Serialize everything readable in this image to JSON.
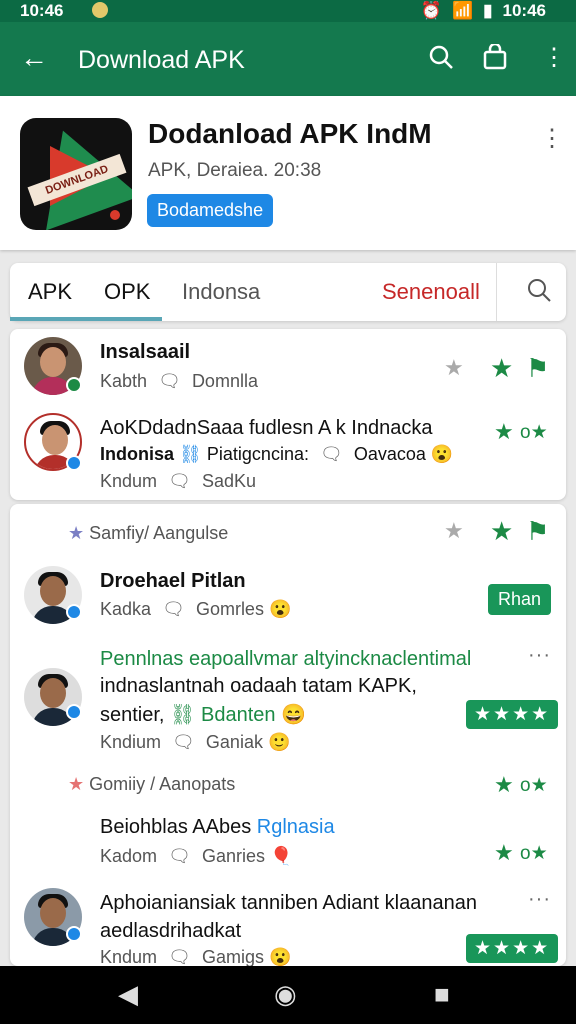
{
  "status_bar": {
    "time": "10:46",
    "right_time": "10:46"
  },
  "app_bar": {
    "title": "Download APK",
    "icons": [
      "back-arrow-icon",
      "search-icon",
      "bag-icon",
      "more-vert-icon"
    ]
  },
  "app": {
    "name": "Dodanload APK IndM",
    "subtitle": "APK, Deraiea. 20:38",
    "badge": "Bodamedshe",
    "icon_text": "DOWNLOAD"
  },
  "tabs": [
    {
      "label": "APK"
    },
    {
      "label": "OPK"
    },
    {
      "label": "Indonsa"
    },
    {
      "label": "Senenoall"
    }
  ],
  "reviews1": [
    {
      "name": "Insalsaail",
      "meta1": "Kabth",
      "meta2": "Domnlla"
    },
    {
      "name": "AoKDdadnSaaa fudlesn A k Indnacka",
      "line2a": "Indonisa",
      "line2b": "Piatigcncina:",
      "line2c": "Oavacoa",
      "meta1": "Kndum",
      "meta2": "SadKu"
    }
  ],
  "section1": "Samfiy/ Aangulse",
  "reviews2": [
    {
      "name": "Droehael Pitlan",
      "meta1": "Kadka",
      "meta2": "Gomrles",
      "button": "Rhan"
    },
    {
      "line1": "Pennlnas eapoallvmar altyincknaclentimal",
      "line2": "indnaslantnah oadaah tatam KAPK,",
      "line3a": "sentier,",
      "line3b": "Bdanten",
      "meta1": "Kndium",
      "meta2": "Ganiak",
      "stars": "★★★★"
    }
  ],
  "section2": "Gomiiy / Aanopats",
  "reviews3": [
    {
      "name_a": "Beiohblas AAbes",
      "name_b": "Rglnasia",
      "meta1": "Kadom",
      "meta2": "Ganries"
    },
    {
      "line1": "Aphoianiansiak tanniben Adiant klaananan",
      "line2": "aedlasdrihadkat",
      "meta1": "Kndum",
      "meta2": "Gamigs",
      "stars": "★★★★"
    }
  ]
}
